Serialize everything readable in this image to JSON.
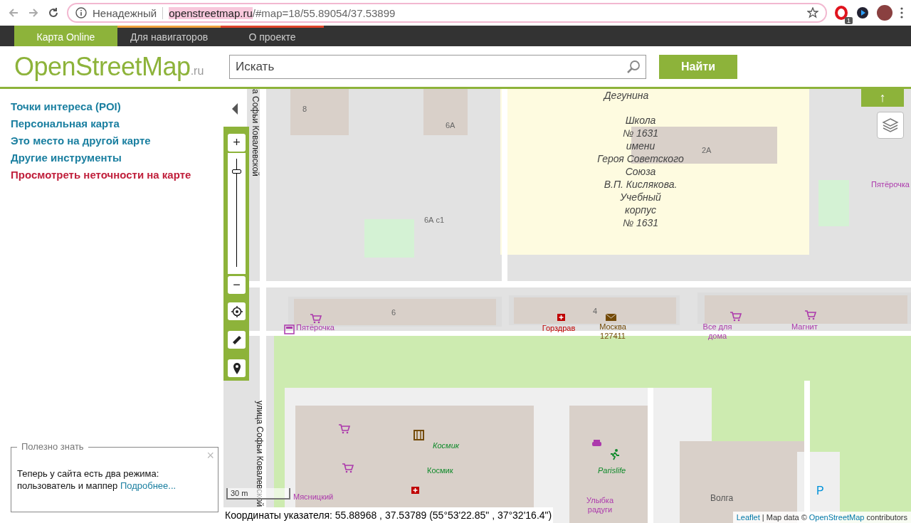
{
  "browser": {
    "security_label": "Ненадежный",
    "url_host": "openstreetmap.ru",
    "url_path": "/#map=18/55.89054/37.53899",
    "extension_badge": "1"
  },
  "nav_tabs": [
    {
      "label": "Карта Online",
      "selected": true,
      "color": "#8db33a"
    },
    {
      "label": "Для навигаторов",
      "selected": false,
      "color": "#f0a03c"
    },
    {
      "label": "О проекте",
      "selected": false,
      "color": "#e0442a"
    }
  ],
  "header": {
    "logo": {
      "text": "OpenStreetMap",
      "suffix": ".ru"
    },
    "search": {
      "placeholder": "Искать"
    },
    "search_button": "Найти"
  },
  "sidebar": {
    "links": [
      {
        "label": "Точки интереса (POI)",
        "kind": "link"
      },
      {
        "label": "Персональная карта",
        "kind": "link"
      },
      {
        "label": "Это место на другой карте",
        "kind": "link"
      },
      {
        "label": "Другие инструменты",
        "kind": "link"
      },
      {
        "label": "Просмотреть неточности на карте",
        "kind": "alert"
      }
    ],
    "tip": {
      "legend": "Полезно знать",
      "close": "×",
      "text": "Теперь у сайта есть два режима: пользователь и маппер",
      "link": "Подробнее..."
    }
  },
  "map": {
    "labels": [
      {
        "text": "а Софьи Ковалевской",
        "kind": "street"
      },
      {
        "text": "улица Софьи Ковалевской",
        "kind": "street"
      },
      {
        "text": "8",
        "kind": "house"
      },
      {
        "text": "6А",
        "kind": "house"
      },
      {
        "text": "Дегунина",
        "kind": "area"
      },
      {
        "text": "Школа\n№ 1631\nимени\nГероя Советского\nСоюза\nВ.П. Кислякова.\nУчебный\nкорпус\n№ 1631",
        "kind": "area"
      },
      {
        "text": "2А",
        "kind": "house"
      },
      {
        "text": "6А с1",
        "kind": "house"
      },
      {
        "text": "Пятёрочка",
        "kind": "shop"
      },
      {
        "text": "6",
        "kind": "house"
      },
      {
        "text": "Пятёрочка",
        "kind": "shop"
      },
      {
        "text": "4",
        "kind": "house"
      },
      {
        "text": "Горздрав",
        "kind": "health"
      },
      {
        "text": "Москва\n127411",
        "kind": "post"
      },
      {
        "text": "Все для\nдома",
        "kind": "shop"
      },
      {
        "text": "Магнит",
        "kind": "shop"
      },
      {
        "text": "Космик",
        "kind": "leisure"
      },
      {
        "text": "Космик",
        "kind": "leisure_plain"
      },
      {
        "text": "Мясницкий",
        "kind": "shop"
      },
      {
        "text": "Parislife",
        "kind": "leisure"
      },
      {
        "text": "Улыбка\nрадуги",
        "kind": "shop"
      },
      {
        "text": "Волга",
        "kind": "building"
      },
      {
        "text": "P",
        "kind": "parking"
      }
    ],
    "zoom": {
      "plus": "+",
      "minus": "−",
      "level": 0.9
    },
    "north_button": "↑",
    "scale": "30 m",
    "coordinates": "Координаты указателя: 55.88968 , 37.53789 (55°53'22.85\" , 37°32'16.4\")",
    "attribution": {
      "leaflet": "Leaflet",
      "text": " | Map data © ",
      "osm": "OpenStreetMap",
      "suffix": " contributors"
    }
  }
}
